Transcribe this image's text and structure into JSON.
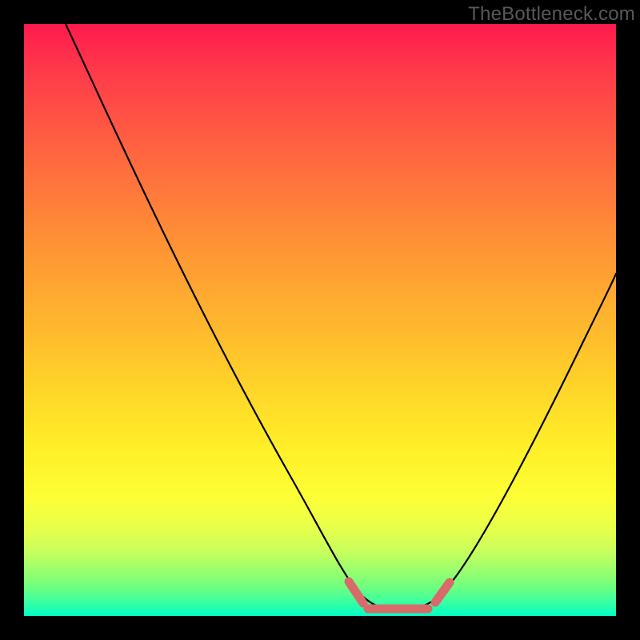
{
  "watermark": "TheBottleneck.com",
  "colors": {
    "background": "#000000",
    "curve": "#000000",
    "marker": "#d96a6a",
    "gradient_top": "#ff1a4d",
    "gradient_bottom": "#00ffc3"
  },
  "chart_data": {
    "type": "line",
    "title": "",
    "xlabel": "",
    "ylabel": "",
    "xlim": [
      0,
      100
    ],
    "ylim": [
      0,
      100
    ],
    "axes_visible": false,
    "grid": false,
    "series": [
      {
        "name": "bottleneck-curve",
        "x": [
          7,
          15,
          25,
          35,
          45,
          52,
          56,
          60,
          64,
          68,
          72,
          80,
          88,
          96,
          100
        ],
        "y": [
          100,
          85,
          66,
          47,
          28,
          14,
          6,
          2,
          1,
          1,
          3,
          12,
          28,
          48,
          59
        ]
      }
    ],
    "markers": [
      {
        "name": "flat-left-edge",
        "x": 56,
        "y": 4.5
      },
      {
        "name": "flat-segment",
        "x_from": 58,
        "x_to": 68,
        "y": 1.5
      },
      {
        "name": "flat-right-edge",
        "x": 71,
        "y": 4.5
      }
    ]
  }
}
